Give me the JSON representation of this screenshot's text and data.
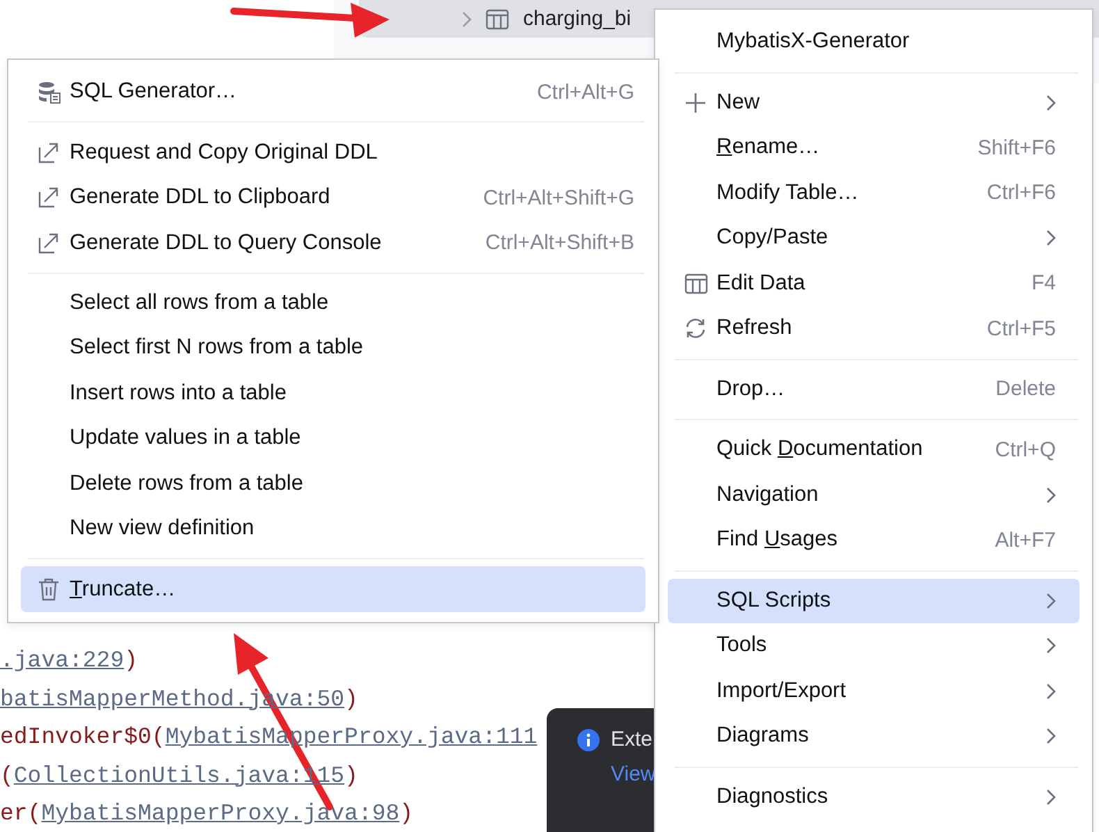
{
  "tree": {
    "rows": [
      {
        "label": "charging_bi",
        "selected": true
      }
    ]
  },
  "console_lines": [
    {
      "parts": [
        {
          "text": ".java:229",
          "link": true
        },
        {
          "text": ")",
          "link": false
        }
      ]
    },
    {
      "parts": [
        {
          "text": "batisMapperMethod.java:50",
          "link": true
        },
        {
          "text": ")",
          "link": false
        }
      ]
    },
    {
      "parts": [
        {
          "text": "edInvoker$0(",
          "link": false
        },
        {
          "text": "MybatisMapperProxy.java:111",
          "link": true
        }
      ]
    },
    {
      "parts": [
        {
          "text": "(",
          "link": false
        },
        {
          "text": "CollectionUtils.java:115",
          "link": true
        },
        {
          "text": ")",
          "link": false
        }
      ]
    },
    {
      "parts": [
        {
          "text": "er(",
          "link": false
        },
        {
          "text": "MybatisMapperProxy.java:98",
          "link": true
        },
        {
          "text": ")",
          "link": false
        }
      ]
    }
  ],
  "notification": {
    "title": "Exte",
    "link": "View"
  },
  "context_menu": {
    "items": [
      {
        "kind": "item",
        "label": "MybatisX-Generator",
        "selected": false
      },
      {
        "kind": "separator"
      },
      {
        "kind": "item",
        "label": "New",
        "submenu": true,
        "selected": false
      },
      {
        "kind": "item",
        "label_parts": [
          {
            "text": "R",
            "underlined": true
          },
          {
            "text": "ename…",
            "underlined": false
          }
        ],
        "shortcut": "Shift+F6",
        "selected": false
      },
      {
        "kind": "item",
        "label": "Modify Table…",
        "shortcut": "Ctrl+F6",
        "selected": false
      },
      {
        "kind": "item",
        "label": "Copy/Paste",
        "submenu": true,
        "selected": false
      },
      {
        "kind": "item",
        "label": "Edit Data",
        "shortcut": "F4",
        "selected": false
      },
      {
        "kind": "item",
        "label": "Refresh",
        "shortcut": "Ctrl+F5",
        "selected": false
      },
      {
        "kind": "separator"
      },
      {
        "kind": "item",
        "label": "Drop…",
        "shortcut": "Delete",
        "selected": false
      },
      {
        "kind": "separator"
      },
      {
        "kind": "item",
        "label_parts": [
          {
            "text": "Quick ",
            "underlined": false
          },
          {
            "text": "D",
            "underlined": true
          },
          {
            "text": "ocumentation",
            "underlined": false
          }
        ],
        "shortcut": "Ctrl+Q",
        "selected": false
      },
      {
        "kind": "item",
        "label": "Navigation",
        "submenu": true,
        "selected": false
      },
      {
        "kind": "item",
        "label_parts": [
          {
            "text": "Find ",
            "underlined": false
          },
          {
            "text": "U",
            "underlined": true
          },
          {
            "text": "sages",
            "underlined": false
          }
        ],
        "shortcut": "Alt+F7",
        "selected": false
      },
      {
        "kind": "separator"
      },
      {
        "kind": "item",
        "label": "SQL Scripts",
        "submenu": true,
        "selected": true
      },
      {
        "kind": "item",
        "label": "Tools",
        "submenu": true,
        "selected": false
      },
      {
        "kind": "item",
        "label": "Import/Export",
        "submenu": true,
        "selected": false
      },
      {
        "kind": "item",
        "label": "Diagrams",
        "submenu": true,
        "selected": false
      },
      {
        "kind": "separator"
      },
      {
        "kind": "item",
        "label": "Diagnostics",
        "submenu": true,
        "selected": false
      }
    ]
  },
  "submenu": {
    "items": [
      {
        "kind": "item",
        "label": "SQL Generator…",
        "shortcut": "Ctrl+Alt+G",
        "selected": false
      },
      {
        "kind": "separator"
      },
      {
        "kind": "item",
        "label": "Request and Copy Original DDL",
        "selected": false
      },
      {
        "kind": "item",
        "label": "Generate DDL to Clipboard",
        "shortcut": "Ctrl+Alt+Shift+G",
        "selected": false
      },
      {
        "kind": "item",
        "label": "Generate DDL to Query Console",
        "shortcut": "Ctrl+Alt+Shift+B",
        "selected": false
      },
      {
        "kind": "separator"
      },
      {
        "kind": "item",
        "label": "Select all rows from a table",
        "selected": false
      },
      {
        "kind": "item",
        "label": "Select first N rows from a table",
        "selected": false
      },
      {
        "kind": "item",
        "label": "Insert rows into a table",
        "selected": false
      },
      {
        "kind": "item",
        "label": "Update values in a table",
        "selected": false
      },
      {
        "kind": "item",
        "label": "Delete rows from a table",
        "selected": false
      },
      {
        "kind": "item",
        "label": "New view definition",
        "selected": false
      },
      {
        "kind": "separator"
      },
      {
        "kind": "item",
        "label_parts": [
          {
            "text": "T",
            "underlined": true
          },
          {
            "text": "runcate…",
            "underlined": false
          }
        ],
        "selected": true
      }
    ]
  }
}
